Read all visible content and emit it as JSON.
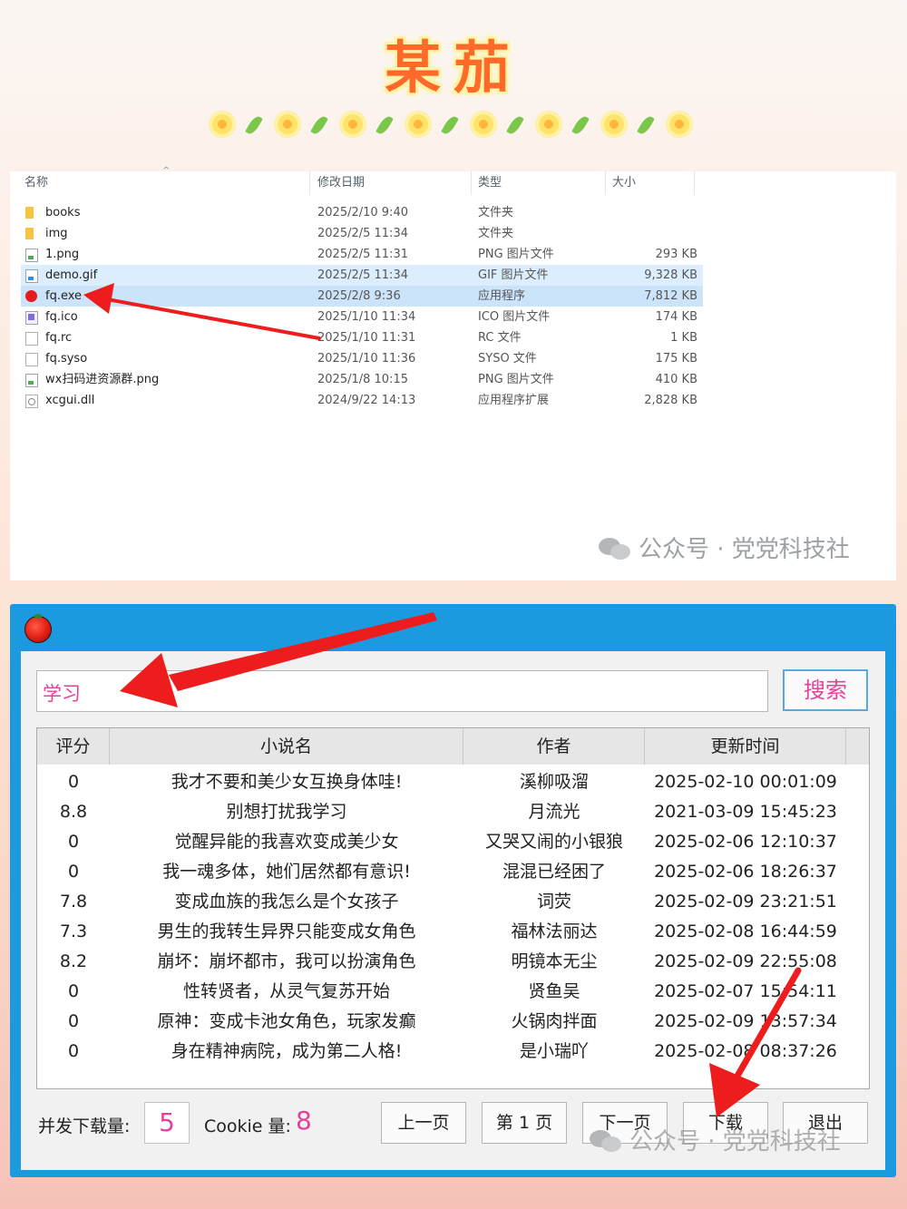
{
  "headline": "某茄",
  "explorer": {
    "columns": {
      "name": "名称",
      "modified": "修改日期",
      "type": "类型",
      "size": "大小"
    },
    "files": [
      {
        "name": "books",
        "date": "2025/2/10 9:40",
        "type": "文件夹",
        "size": "",
        "icon": "folder-icon"
      },
      {
        "name": "img",
        "date": "2025/2/5 11:34",
        "type": "文件夹",
        "size": "",
        "icon": "folder-icon"
      },
      {
        "name": "1.png",
        "date": "2025/2/5 11:31",
        "type": "PNG 图片文件",
        "size": "293 KB",
        "icon": "image-file-icon"
      },
      {
        "name": "demo.gif",
        "date": "2025/2/5 11:34",
        "type": "GIF 图片文件",
        "size": "9,328 KB",
        "icon": "gif-file-icon"
      },
      {
        "name": "fq.exe",
        "date": "2025/2/8 9:36",
        "type": "应用程序",
        "size": "7,812 KB",
        "icon": "tomato-app-icon"
      },
      {
        "name": "fq.ico",
        "date": "2025/1/10 11:34",
        "type": "ICO 图片文件",
        "size": "174 KB",
        "icon": "ico-file-icon"
      },
      {
        "name": "fq.rc",
        "date": "2025/1/10 11:31",
        "type": "RC 文件",
        "size": "1 KB",
        "icon": "file-icon"
      },
      {
        "name": "fq.syso",
        "date": "2025/1/10 11:36",
        "type": "SYSO 文件",
        "size": "175 KB",
        "icon": "file-icon"
      },
      {
        "name": "wx扫码进资源群.png",
        "date": "2025/1/8 10:15",
        "type": "PNG 图片文件",
        "size": "410 KB",
        "icon": "image-file-icon"
      },
      {
        "name": "xcgui.dll",
        "date": "2024/9/22 14:13",
        "type": "应用程序扩展",
        "size": "2,828 KB",
        "icon": "dll-file-icon"
      }
    ]
  },
  "watermark": "公众号 · 党党科技社",
  "app": {
    "search_value": "学习",
    "search_button": "搜索",
    "columns": {
      "score": "评分",
      "name": "小说名",
      "author": "作者",
      "updated": "更新时间"
    },
    "rows": [
      {
        "score": "0",
        "name": "我才不要和美少女互换身体哇!",
        "author": "溪柳吸溜",
        "updated": "2025-02-10 00:01:09"
      },
      {
        "score": "8.8",
        "name": "别想打扰我学习",
        "author": "月流光",
        "updated": "2021-03-09 15:45:23"
      },
      {
        "score": "0",
        "name": "觉醒异能的我喜欢变成美少女",
        "author": "又哭又闹的小银狼",
        "updated": "2025-02-06 12:10:37"
      },
      {
        "score": "0",
        "name": "我一魂多体，她们居然都有意识!",
        "author": "混混已经困了",
        "updated": "2025-02-06 18:26:37"
      },
      {
        "score": "7.8",
        "name": "变成血族的我怎么是个女孩子",
        "author": "词荧",
        "updated": "2025-02-09 23:21:51"
      },
      {
        "score": "7.3",
        "name": "男生的我转生异界只能变成女角色",
        "author": "福林法丽达",
        "updated": "2025-02-08 16:44:59"
      },
      {
        "score": "8.2",
        "name": "崩坏：崩坏都市，我可以扮演角色",
        "author": "明镜本无尘",
        "updated": "2025-02-09 22:55:08"
      },
      {
        "score": "0",
        "name": "性转贤者，从灵气复苏开始",
        "author": "贤鱼吴",
        "updated": "2025-02-07 15:54:11"
      },
      {
        "score": "0",
        "name": "原神：变成卡池女角色，玩家发癫",
        "author": "火锅肉拌面",
        "updated": "2025-02-09 13:57:34"
      },
      {
        "score": "0",
        "name": "身在精神病院，成为第二人格!",
        "author": "是小瑞吖",
        "updated": "2025-02-08 08:37:26"
      }
    ],
    "concurrency_label": "并发下载量:",
    "concurrency_value": "5",
    "cookie_label": "Cookie 量:",
    "cookie_value": "8",
    "buttons": {
      "prev": "上一页",
      "page": "第 1 页",
      "next": "下一页",
      "download": "下载",
      "exit": "退出"
    }
  },
  "colors": {
    "accent_pink": "#e6409a",
    "window_blue": "#1b9ae0",
    "arrow_red": "#ee1d1d",
    "headline_orange": "#ff6a2a"
  }
}
